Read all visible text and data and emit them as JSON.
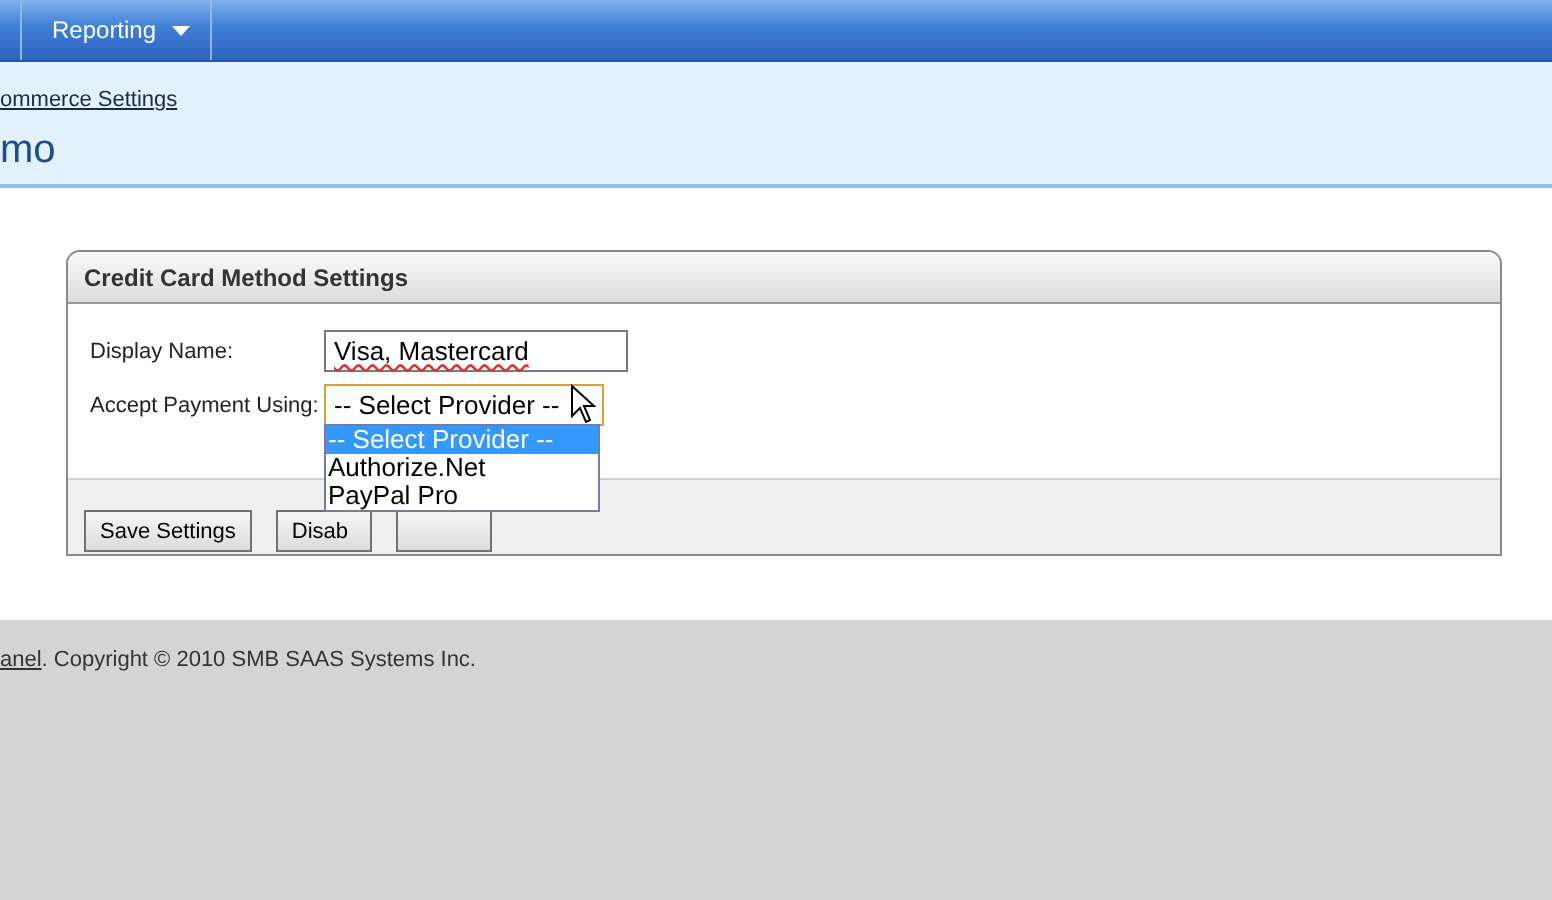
{
  "nav": {
    "items": [
      {
        "label": "Reporting",
        "dropdown": true
      }
    ]
  },
  "breadcrumb": {
    "link": "ommerce Settings"
  },
  "page_title": "mo",
  "panel": {
    "title": "Credit Card Method Settings",
    "fields": [
      {
        "label": "Display Name:",
        "kind": "text",
        "value": "Visa, Mastercard"
      },
      {
        "label": "Accept Payment Using:",
        "kind": "select",
        "value": "-- Select Provider --",
        "expanded": true,
        "options": [
          {
            "label": "-- Select Provider --",
            "selected": true
          },
          {
            "label": "Authorize.Net",
            "selected": false
          },
          {
            "label": "PayPal Pro",
            "selected": false
          }
        ]
      }
    ],
    "buttons": [
      {
        "kind": "labeled",
        "label": "Save Settings"
      },
      {
        "kind": "labeled",
        "label": "Disab"
      },
      {
        "kind": "covered"
      }
    ]
  },
  "footer": {
    "link": "anel",
    "text": ". Copyright © 2010 SMB SAAS Systems Inc."
  }
}
